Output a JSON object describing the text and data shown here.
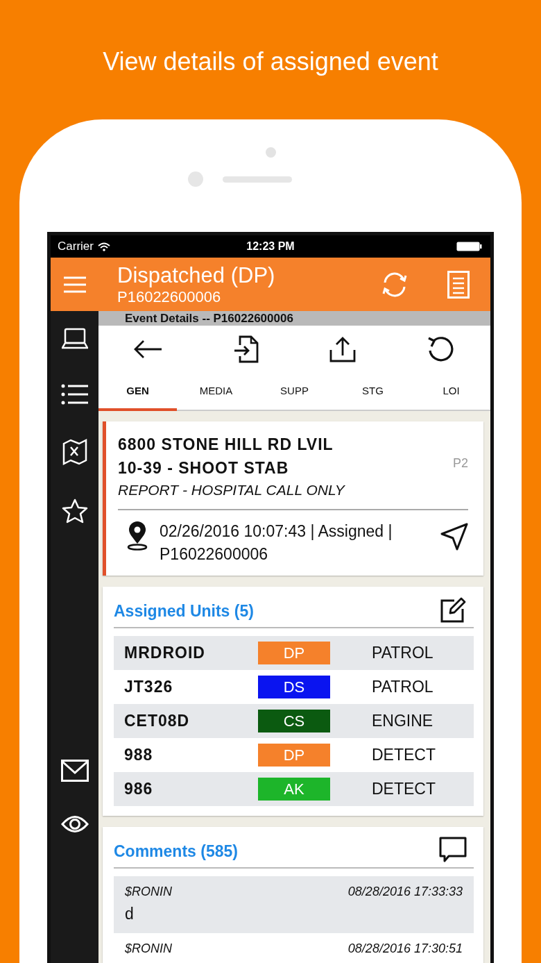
{
  "headline": "View details of assigned event",
  "status_bar": {
    "carrier": "Carrier",
    "time": "12:23 PM"
  },
  "header": {
    "title": "Dispatched (DP)",
    "subtitle": "P16022600006"
  },
  "event_bar": "Event Details -- P16022600006",
  "tabs": [
    {
      "label": "GEN",
      "selected": true
    },
    {
      "label": "MEDIA",
      "selected": false
    },
    {
      "label": "SUPP",
      "selected": false
    },
    {
      "label": "STG",
      "selected": false
    },
    {
      "label": "LOI",
      "selected": false
    }
  ],
  "event": {
    "address": "6800 STONE HILL RD LVIL",
    "type": "10-39 - SHOOT STAB",
    "note": "REPORT - HOSPITAL CALL ONLY",
    "priority": "P2",
    "details": "02/26/2016 10:07:43 | Assigned | P16022600006"
  },
  "units": {
    "title": "Assigned Units (5)",
    "rows": [
      {
        "name": "MRDROID",
        "status": "DP",
        "color": "#f5812b",
        "type": "PATROL"
      },
      {
        "name": "JT326",
        "status": "DS",
        "color": "#0a14f0",
        "type": "PATROL"
      },
      {
        "name": "CET08D",
        "status": "CS",
        "color": "#0b5a10",
        "type": "ENGINE"
      },
      {
        "name": "988",
        "status": "DP",
        "color": "#f5812b",
        "type": "DETECT"
      },
      {
        "name": "986",
        "status": "AK",
        "color": "#1db52a",
        "type": "DETECT"
      }
    ]
  },
  "comments": {
    "title": "Comments (585)",
    "items": [
      {
        "author": "$RONIN",
        "time": "08/28/2016 17:33:33",
        "text": "d"
      },
      {
        "author": "$RONIN",
        "time": "08/28/2016 17:30:51"
      }
    ]
  }
}
